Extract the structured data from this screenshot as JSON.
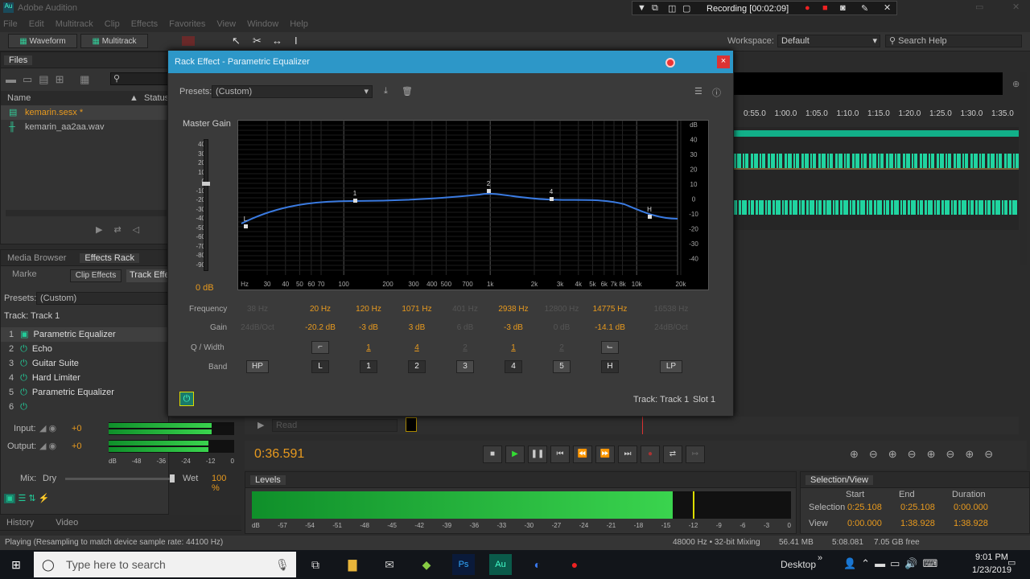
{
  "window": {
    "title": "Adobe Audition"
  },
  "menu": [
    "File",
    "Edit",
    "Multitrack",
    "Clip",
    "Effects",
    "Favorites",
    "View",
    "Window",
    "Help"
  ],
  "recording": {
    "label": "Recording [00:02:09]"
  },
  "toolbar": {
    "waveform": "Waveform",
    "multitrack": "Multitrack",
    "workspace_label": "Workspace:",
    "workspace_value": "Default",
    "search_placeholder": "Search Help"
  },
  "files": {
    "tab": "Files",
    "col_name": "Name",
    "col_status": "Status",
    "items": [
      "kemarin.sesx *",
      "kemarin_aa2aa.wav"
    ]
  },
  "effects": {
    "tabs": [
      "Media Browser",
      "Effects Rack",
      "Marke"
    ],
    "subtabs": [
      "Clip Effects",
      "Track Effec"
    ],
    "presets_label": "Presets:",
    "presets_value": "(Custom)",
    "track": "Track: Track 1",
    "items": [
      {
        "n": "1",
        "label": "Parametric Equalizer"
      },
      {
        "n": "2",
        "label": "Echo"
      },
      {
        "n": "3",
        "label": "Guitar Suite"
      },
      {
        "n": "4",
        "label": "Hard Limiter"
      },
      {
        "n": "5",
        "label": "Parametric Equalizer"
      },
      {
        "n": "6",
        "label": ""
      }
    ],
    "input": "Input:",
    "input_val": "+0",
    "output": "Output:",
    "output_val": "+0",
    "mix": "Mix:",
    "dry": "Dry",
    "wet": "Wet",
    "wet_val": "100 %",
    "meter_ticks": [
      "dB",
      "-48",
      "-36",
      "-24",
      "-12",
      "0"
    ]
  },
  "bottom_tabs": {
    "history": "History",
    "video": "Video"
  },
  "status": {
    "left": "Playing (Resampling to match device sample rate: 44100 Hz)",
    "sr": "48000 Hz • 32-bit Mixing",
    "mem": "56.41 MB",
    "dur": "5:08.081",
    "free": "7.05 GB free"
  },
  "dialog": {
    "title": "Rack Effect - Parametric Equalizer",
    "presets_label": "Presets:",
    "presets_value": "(Custom)",
    "master_gain": "Master Gain",
    "master_val": "0 dB",
    "gain_scale": [
      "40",
      "30",
      "20",
      "10",
      "0",
      "-10",
      "-20",
      "-30",
      "-40",
      "-50",
      "-60",
      "-70",
      "-80",
      "-90"
    ],
    "db_scale": [
      "dB",
      "40",
      "30",
      "20",
      "10",
      "0",
      "-10",
      "-20",
      "-30",
      "-40"
    ],
    "freq_scale": [
      "Hz",
      "30",
      "40",
      "50",
      "60",
      "70",
      "100",
      "200",
      "300",
      "400",
      "500",
      "700",
      "1k",
      "2k",
      "3k",
      "4k",
      "5k",
      "6k",
      "7k",
      "8k",
      "10k",
      "20k"
    ],
    "row_labels": {
      "freq": "Frequency",
      "gain": "Gain",
      "q": "Q / Width",
      "band": "Band"
    },
    "bands": [
      {
        "freq": "38 Hz",
        "gain": "24dB/Oct",
        "q": "",
        "band": "HP",
        "dim": true
      },
      {
        "freq": "20 Hz",
        "gain": "-20.2 dB",
        "q": "shelf",
        "band": "L",
        "dim": false
      },
      {
        "freq": "120 Hz",
        "gain": "-3 dB",
        "q": "1",
        "band": "1",
        "dim": false
      },
      {
        "freq": "1071 Hz",
        "gain": "3 dB",
        "q": "4",
        "band": "2",
        "dim": false
      },
      {
        "freq": "401 Hz",
        "gain": "6 dB",
        "q": "2",
        "band": "3",
        "dim": true
      },
      {
        "freq": "2938 Hz",
        "gain": "-3 dB",
        "q": "1",
        "band": "4",
        "dim": false
      },
      {
        "freq": "12800 Hz",
        "gain": "0 dB",
        "q": "2",
        "band": "5",
        "dim": true
      },
      {
        "freq": "14775 Hz",
        "gain": "-14.1 dB",
        "q": "shelf",
        "band": "H",
        "dim": false
      },
      {
        "freq": "16538 Hz",
        "gain": "24dB/Oct",
        "q": "",
        "band": "LP",
        "dim": true
      }
    ],
    "footer_track": "Track: Track 1",
    "footer_slot": "Slot 1",
    "nodes": [
      "L",
      "1",
      "2",
      "4",
      "H"
    ]
  },
  "timeline": {
    "ruler": [
      "0:55.0",
      "1:00.0",
      "1:05.0",
      "1:10.0",
      "1:15.0",
      "1:20.0",
      "1:25.0",
      "1:30.0",
      "1:35.0"
    ],
    "read": "Read"
  },
  "transport": {
    "time": "0:36.591"
  },
  "levels": {
    "tab": "Levels",
    "ticks": [
      "dB",
      "-57",
      "-54",
      "-51",
      "-48",
      "-45",
      "-42",
      "-39",
      "-36",
      "-33",
      "-30",
      "-27",
      "-24",
      "-21",
      "-18",
      "-15",
      "-12",
      "-9",
      "-6",
      "-3",
      "0"
    ],
    "fill": 0.78
  },
  "selection": {
    "tab": "Selection/View",
    "start": "Start",
    "end": "End",
    "duration": "Duration",
    "sel_label": "Selection",
    "sel_start": "0:25.108",
    "sel_end": "0:25.108",
    "sel_dur": "0:00.000",
    "view_label": "View",
    "view_start": "0:00.000",
    "view_end": "1:38.928",
    "view_dur": "1:38.928"
  },
  "taskbar": {
    "search": "Type here to search",
    "desktop": "Desktop",
    "time": "9:01 PM",
    "date": "1/23/2019"
  }
}
